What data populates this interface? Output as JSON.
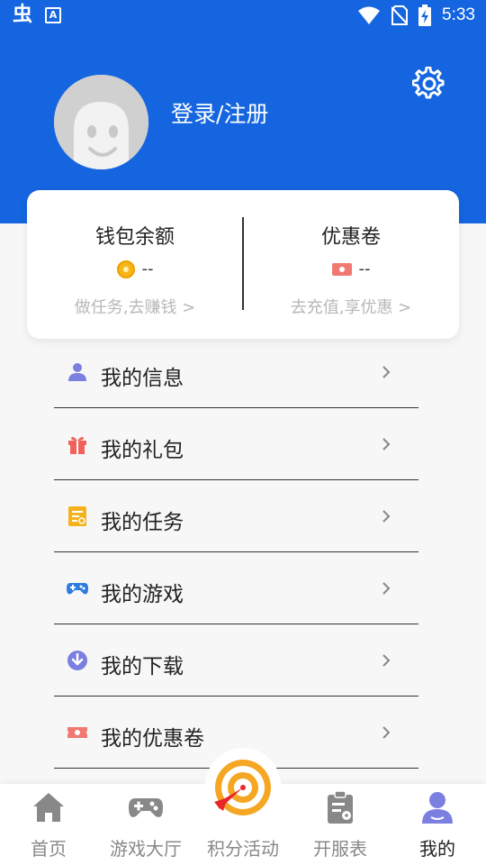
{
  "status_bar": {
    "left_glyph": "虫",
    "left_badge": "A",
    "time": "5:33"
  },
  "header": {
    "login_label": "登录/注册"
  },
  "wallet": {
    "balance_title": "钱包余额",
    "balance_value": "--",
    "balance_hint": "做任务,去赚钱 >",
    "coupon_title": "优惠卷",
    "coupon_value": "--",
    "coupon_hint": "去充值,享优惠 >"
  },
  "menu": {
    "items": [
      {
        "label": "我的信息",
        "icon": "person-icon"
      },
      {
        "label": "我的礼包",
        "icon": "gift-icon"
      },
      {
        "label": "我的任务",
        "icon": "task-icon"
      },
      {
        "label": "我的游戏",
        "icon": "gamepad-icon"
      },
      {
        "label": "我的下载",
        "icon": "download-icon"
      },
      {
        "label": "我的优惠卷",
        "icon": "coupon-icon"
      }
    ]
  },
  "tabs": {
    "items": [
      {
        "label": "首页",
        "icon": "home-icon"
      },
      {
        "label": "游戏大厅",
        "icon": "gamepad-icon"
      },
      {
        "label": "积分活动",
        "icon": "target-icon"
      },
      {
        "label": "开服表",
        "icon": "clipboard-icon"
      },
      {
        "label": "我的",
        "icon": "user-icon"
      }
    ],
    "active_index": 4
  },
  "colors": {
    "brand_blue": "#1565e0",
    "accent_purple": "#7b7fe0",
    "gift_red": "#f0635a",
    "task_orange": "#f5b21c",
    "game_blue": "#2f7be0",
    "coin_gold": "#f7b51c",
    "target_orange": "#f5a623"
  }
}
